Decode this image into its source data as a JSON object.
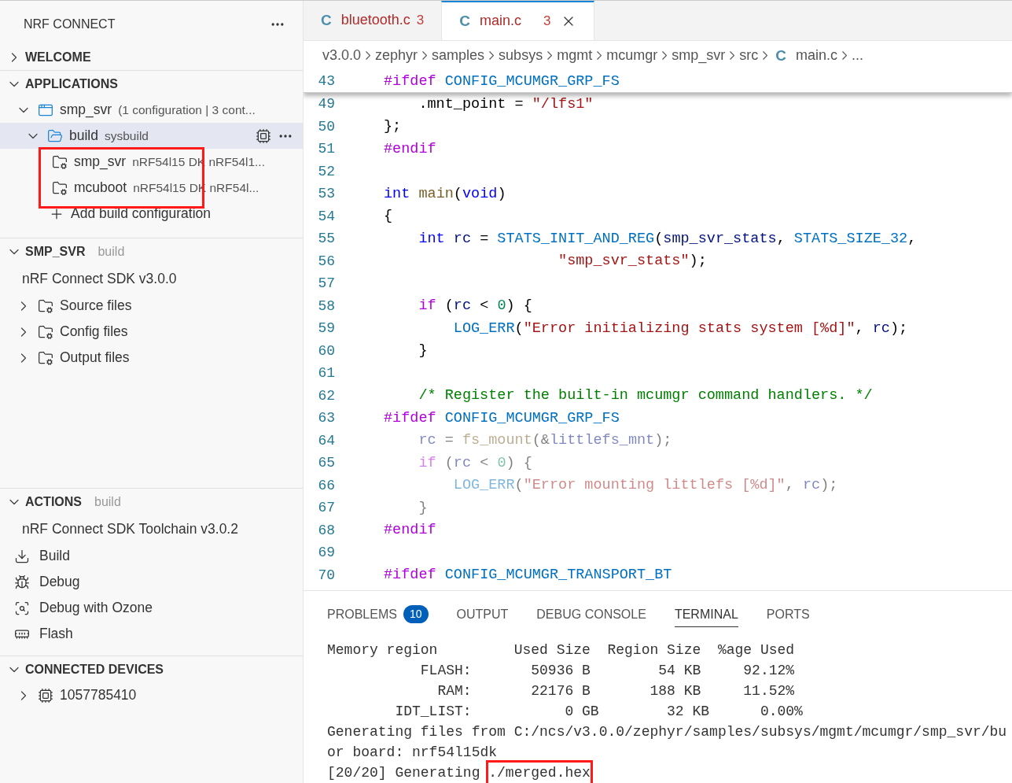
{
  "sidebar": {
    "title": "NRF CONNECT",
    "welcome": {
      "label": "WELCOME",
      "expanded": false
    },
    "applications": {
      "label": "APPLICATIONS",
      "expanded": true,
      "tree": [
        {
          "kind": "app",
          "label": "smp_svr",
          "description": "(1 configuration | 3 cont...",
          "expanded": true,
          "selected": false,
          "children": [
            {
              "kind": "build",
              "label": "build",
              "description": "sysbuild",
              "expanded": true,
              "selected": true,
              "highlight_children": true,
              "children": [
                {
                  "kind": "image",
                  "label": "smp_svr",
                  "description": "nRF54l15 DK nRF54l1...",
                  "selected": false
                },
                {
                  "kind": "image",
                  "label": "mcuboot",
                  "description": "nRF54l15 DK nRF54l...",
                  "selected": false
                }
              ]
            }
          ]
        }
      ],
      "add_action": "Add build configuration"
    },
    "project": {
      "label": "SMP_SVR",
      "subtitle": "build",
      "expanded": true,
      "sdk": "nRF Connect SDK v3.0.0",
      "items": [
        {
          "label": "Source files",
          "expanded": false
        },
        {
          "label": "Config files",
          "expanded": false
        },
        {
          "label": "Output files",
          "expanded": false
        }
      ]
    },
    "actions": {
      "label": "ACTIONS",
      "subtitle": "build",
      "expanded": true,
      "toolchain": "nRF Connect SDK Toolchain v3.0.2",
      "items": [
        {
          "kind": "build",
          "label": "Build"
        },
        {
          "kind": "debug",
          "label": "Debug"
        },
        {
          "kind": "ozone",
          "label": "Debug with Ozone"
        },
        {
          "kind": "flash",
          "label": "Flash"
        }
      ]
    },
    "devices": {
      "label": "CONNECTED DEVICES",
      "expanded": true,
      "items": [
        {
          "label": "1057785410",
          "expanded": false
        }
      ]
    }
  },
  "tabs": [
    {
      "icon": "C",
      "label": "bluetooth.c",
      "problems": "3",
      "selected": false
    },
    {
      "icon": "C",
      "label": "main.c",
      "problems": "3",
      "selected": true
    }
  ],
  "breadcrumbs": [
    "v3.0.0",
    "zephyr",
    "samples",
    "subsys",
    "mgmt",
    "mcumgr",
    "smp_svr",
    "src",
    {
      "icon": "C",
      "label": "main.c"
    },
    "..."
  ],
  "code": [
    {
      "number": "43",
      "sticky": true,
      "inactive": false,
      "tokens": [
        {
          "kind": "pp",
          "text": "#ifdef "
        },
        {
          "kind": "macro",
          "text": "CONFIG_MCUMGR_GRP_FS"
        }
      ]
    },
    {
      "number": "49",
      "inactive": false,
      "tokens": [
        {
          "kind": "plain",
          "text": "    .mnt_point = "
        },
        {
          "kind": "str",
          "text": "\"/lfs1\""
        }
      ]
    },
    {
      "number": "50",
      "inactive": false,
      "tokens": [
        {
          "kind": "plain",
          "text": "};"
        }
      ]
    },
    {
      "number": "51",
      "inactive": false,
      "tokens": [
        {
          "kind": "pp",
          "text": "#endif"
        }
      ]
    },
    {
      "number": "52"
    },
    {
      "number": "53",
      "inactive": false,
      "tokens": [
        {
          "kind": "kw",
          "text": "int "
        },
        {
          "kind": "fn",
          "text": "main"
        },
        {
          "kind": "plain",
          "text": "("
        },
        {
          "kind": "kw",
          "text": "void"
        },
        {
          "kind": "plain",
          "text": ")"
        }
      ]
    },
    {
      "number": "54",
      "inactive": false,
      "tokens": [
        {
          "kind": "plain",
          "text": "{"
        }
      ]
    },
    {
      "number": "55",
      "inactive": false,
      "tokens": [
        {
          "kind": "kw",
          "text": "    int"
        },
        {
          "kind": "var",
          "text": " rc"
        },
        {
          "kind": "plain",
          "text": " = "
        },
        {
          "kind": "macro",
          "text": "STATS_INIT_AND_REG"
        },
        {
          "kind": "plain",
          "text": "("
        },
        {
          "kind": "var",
          "text": "smp_svr_stats"
        },
        {
          "kind": "plain",
          "text": ", "
        },
        {
          "kind": "macro",
          "text": "STATS_SIZE_32"
        },
        {
          "kind": "plain",
          "text": ","
        }
      ]
    },
    {
      "number": "56",
      "inactive": false,
      "tokens": [
        {
          "kind": "str",
          "text": "                    \"smp_svr_stats\""
        },
        {
          "kind": "plain",
          "text": ");"
        }
      ]
    },
    {
      "number": "57"
    },
    {
      "number": "58",
      "inactive": false,
      "tokens": [
        {
          "kind": "pp",
          "text": "    if"
        },
        {
          "kind": "plain",
          "text": " ("
        },
        {
          "kind": "var",
          "text": "rc"
        },
        {
          "kind": "plain",
          "text": " < "
        },
        {
          "kind": "num",
          "text": "0"
        },
        {
          "kind": "plain",
          "text": ") {"
        }
      ]
    },
    {
      "number": "59",
      "inactive": false,
      "tokens": [
        {
          "kind": "macro",
          "text": "        LOG_ERR"
        },
        {
          "kind": "plain",
          "text": "("
        },
        {
          "kind": "str",
          "text": "\"Error initializing stats system [%d]\""
        },
        {
          "kind": "plain",
          "text": ", "
        },
        {
          "kind": "var",
          "text": "rc"
        },
        {
          "kind": "plain",
          "text": ");"
        }
      ]
    },
    {
      "number": "60",
      "inactive": false,
      "tokens": [
        {
          "kind": "plain",
          "text": "    }"
        }
      ]
    },
    {
      "number": "61"
    },
    {
      "number": "62",
      "inactive": false,
      "tokens": [
        {
          "kind": "comment",
          "text": "    /* Register the built-in mcumgr command handlers. */"
        }
      ]
    },
    {
      "number": "63",
      "inactive": false,
      "tokens": [
        {
          "kind": "pp",
          "text": "#ifdef "
        },
        {
          "kind": "macro",
          "text": "CONFIG_MCUMGR_GRP_FS"
        }
      ]
    },
    {
      "number": "64",
      "inactive": true,
      "tokens": [
        {
          "kind": "var",
          "text": "    rc"
        },
        {
          "kind": "plain",
          "text": " = "
        },
        {
          "kind": "fn",
          "text": "fs_mount"
        },
        {
          "kind": "plain",
          "text": "(&"
        },
        {
          "kind": "var",
          "text": "littlefs_mnt"
        },
        {
          "kind": "plain",
          "text": ");"
        }
      ]
    },
    {
      "number": "65",
      "inactive": true,
      "tokens": [
        {
          "kind": "pp",
          "text": "    if"
        },
        {
          "kind": "plain",
          "text": " ("
        },
        {
          "kind": "var",
          "text": "rc"
        },
        {
          "kind": "plain",
          "text": " < "
        },
        {
          "kind": "num",
          "text": "0"
        },
        {
          "kind": "plain",
          "text": ") {"
        }
      ]
    },
    {
      "number": "66",
      "inactive": true,
      "tokens": [
        {
          "kind": "macro",
          "text": "        LOG_ERR"
        },
        {
          "kind": "plain",
          "text": "("
        },
        {
          "kind": "str",
          "text": "\"Error mounting littlefs [%d]\""
        },
        {
          "kind": "plain",
          "text": ", "
        },
        {
          "kind": "var",
          "text": "rc"
        },
        {
          "kind": "plain",
          "text": ");"
        }
      ]
    },
    {
      "number": "67",
      "inactive": true,
      "tokens": [
        {
          "kind": "plain",
          "text": "    }"
        }
      ]
    },
    {
      "number": "68",
      "inactive": false,
      "tokens": [
        {
          "kind": "pp",
          "text": "#endif"
        }
      ]
    },
    {
      "number": "69"
    },
    {
      "number": "70",
      "inactive": false,
      "tokens": [
        {
          "kind": "pp",
          "text": "#ifdef "
        },
        {
          "kind": "macro",
          "text": "CONFIG_MCUMGR_TRANSPORT_BT"
        }
      ]
    }
  ],
  "panel_tabs": [
    {
      "label": "PROBLEMS",
      "badge": "10",
      "selected": false
    },
    {
      "label": "OUTPUT",
      "selected": false
    },
    {
      "label": "DEBUG CONSOLE",
      "selected": false
    },
    {
      "label": "TERMINAL",
      "selected": true
    },
    {
      "label": "PORTS",
      "selected": false
    }
  ],
  "terminal": [
    [
      {
        "text": "Memory region         Used Size  Region Size  %age Used",
        "highlighted": false
      }
    ],
    [
      {
        "text": "           FLASH:       50936 B        54 KB     92.12%",
        "highlighted": false
      }
    ],
    [
      {
        "text": "             RAM:       22176 B       188 KB     11.52%",
        "highlighted": false
      }
    ],
    [
      {
        "text": "        IDT_LIST:           0 GB        32 KB      0.00%",
        "highlighted": false
      }
    ],
    [
      {
        "text": "Generating files from C:/ncs/v3.0.0/zephyr/samples/subsys/mgmt/mcumgr/smp_svr/bu",
        "highlighted": false
      }
    ],
    [
      {
        "text": "or board: nrf54l15dk",
        "highlighted": false
      }
    ],
    [
      {
        "text": "[20/20] Generating ",
        "highlighted": false
      },
      {
        "text": "./merged.hex",
        "highlighted": true
      }
    ]
  ]
}
